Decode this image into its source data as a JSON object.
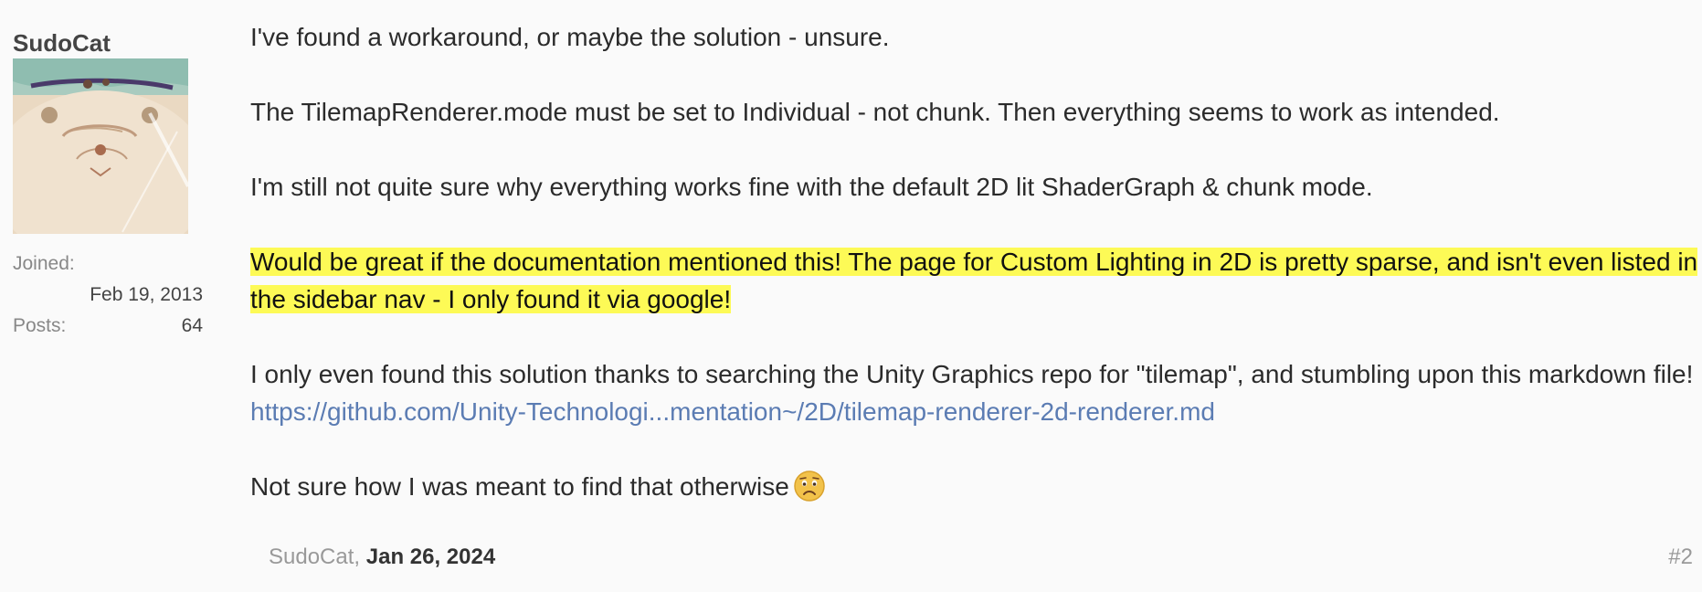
{
  "author": {
    "username": "SudoCat",
    "joined_label": "Joined:",
    "joined_value": "Feb 19, 2013",
    "posts_label": "Posts:",
    "posts_value": "64"
  },
  "post": {
    "p1": "I've found a workaround, or maybe the solution - unsure.",
    "p2": "The TilemapRenderer.mode must be set to Individual - not chunk. Then everything seems to work as intended.",
    "p3": "I'm still not quite sure why everything works fine with the default 2D lit ShaderGraph & chunk mode.",
    "p4_highlighted": "Would be great if the documentation mentioned this! The page for Custom Lighting in 2D is pretty sparse, and isn't even listed in the sidebar nav - I only found it via google!",
    "p5_text": "I only even found this solution thanks to searching the Unity Graphics repo for \"tilemap\", and stumbling upon this markdown file!",
    "p5_link": "https://github.com/Unity-Technologi...mentation~/2D/tilemap-renderer-2d-renderer.md",
    "p6_text": "Not sure how I was meant to find that otherwise",
    "p6_emoji": "frowning-face-emoji"
  },
  "footer": {
    "author_prefix": "SudoCat,",
    "date": "Jan 26, 2024",
    "post_number": "#2"
  }
}
